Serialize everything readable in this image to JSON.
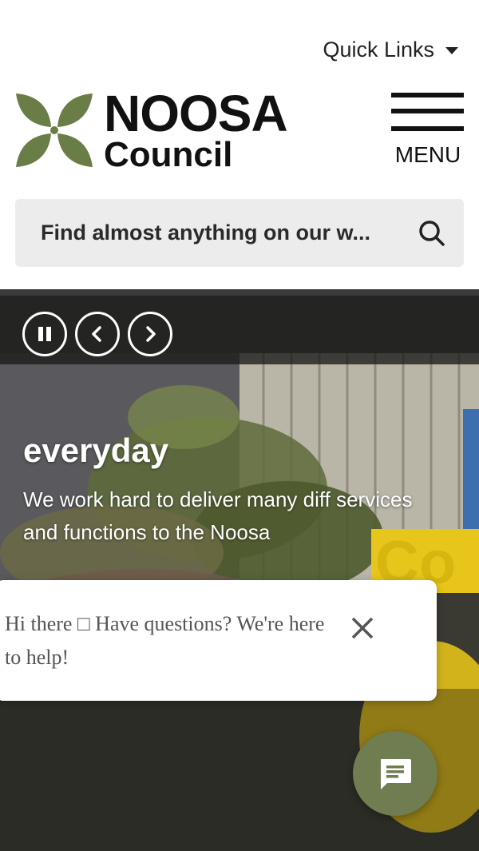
{
  "header": {
    "quick_links_label": "Quick Links",
    "logo_title": "NOOSA",
    "logo_subtitle": "Council",
    "menu_label": "MENU"
  },
  "search": {
    "placeholder": "Find almost anything on our w..."
  },
  "carousel": {
    "controls": [
      "pause-icon",
      "chevron-left-icon",
      "chevron-right-icon"
    ]
  },
  "hero": {
    "heading": "everyday",
    "body": "We work hard to deliver many diff services and functions to the Noosa"
  },
  "chat": {
    "message": "Hi there □ Have questions? We're here to help!"
  },
  "colors": {
    "brand_green": "#6b7d47",
    "chat_fab": "#6f7d50",
    "search_bg": "#ececec"
  }
}
